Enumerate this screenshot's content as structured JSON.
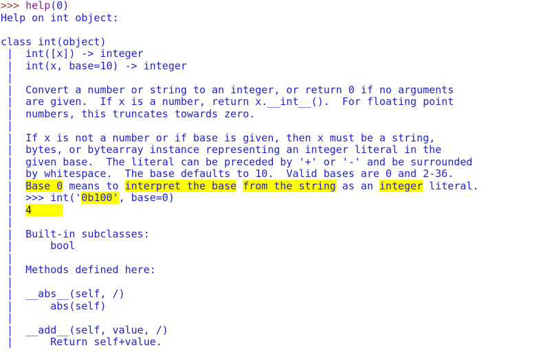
{
  "terminal": {
    "app": "python-repl-help-output",
    "background_color": "#ffffff",
    "text_color": "#2222cc",
    "prompt_color": "#9b3d1e",
    "function_color": "#8b1a8b",
    "highlight_color": "#ffff00",
    "font_size_px": 15,
    "line_height_px": 17.5,
    "columns": 80,
    "lines": [
      {
        "id": "line-1-prompt-help-call",
        "segments": [
          {
            "text": ">>> ",
            "style": "prompt"
          },
          {
            "text": "help",
            "style": "function"
          },
          {
            "text": "(0)",
            "style": "body"
          }
        ]
      },
      {
        "id": "line-2-help-on-int-object",
        "segments": [
          {
            "text": "Help on int object:",
            "style": "body"
          }
        ]
      },
      {
        "id": "line-3-blank",
        "segments": [
          {
            "text": "",
            "style": "body"
          }
        ]
      },
      {
        "id": "line-4-class-int-object",
        "segments": [
          {
            "text": "class int(object)",
            "style": "body"
          }
        ]
      },
      {
        "id": "line-5-signature-int-x",
        "segments": [
          {
            "text": " |  int([x]) -> integer",
            "style": "body"
          }
        ]
      },
      {
        "id": "line-6-signature-int-x-base",
        "segments": [
          {
            "text": " |  int(x, base=10) -> integer",
            "style": "body"
          }
        ]
      },
      {
        "id": "line-7-pipe",
        "segments": [
          {
            "text": " |  ",
            "style": "body"
          }
        ]
      },
      {
        "id": "line-8-convert-description",
        "segments": [
          {
            "text": " |  Convert a number or string to an integer, or return 0 if no arguments",
            "style": "body"
          }
        ]
      },
      {
        "id": "line-9-convert-description-cont",
        "segments": [
          {
            "text": " |  are given.  If x is a number, return x.__int__().  For floating point",
            "style": "body"
          }
        ]
      },
      {
        "id": "line-10-convert-description-cont2",
        "segments": [
          {
            "text": " |  numbers, this truncates towards zero.",
            "style": "body"
          }
        ]
      },
      {
        "id": "line-11-pipe",
        "segments": [
          {
            "text": " |  ",
            "style": "body"
          }
        ]
      },
      {
        "id": "line-12-if-x-not-number",
        "segments": [
          {
            "text": " |  If x is not a number or if base is given, then x must be a string,",
            "style": "body"
          }
        ]
      },
      {
        "id": "line-13-bytes-bytearray",
        "segments": [
          {
            "text": " |  bytes, or bytearray instance representing an integer literal in the",
            "style": "body"
          }
        ]
      },
      {
        "id": "line-14-given-base-literal",
        "segments": [
          {
            "text": " |  given base.  The literal can be preceded by '+' or '-' and be surrounded",
            "style": "body"
          }
        ]
      },
      {
        "id": "line-15-whitespace-base-defaults",
        "segments": [
          {
            "text": " |  by whitespace.  The base defaults to 10.  Valid bases are 0 and 2-36.",
            "style": "body"
          }
        ]
      },
      {
        "id": "line-16-base-0-means-highlighted",
        "segments": [
          {
            "text": " |  ",
            "style": "body"
          },
          {
            "text": "Base 0",
            "style": "highlight"
          },
          {
            "text": " means to ",
            "style": "body"
          },
          {
            "text": "interpret the base",
            "style": "highlight"
          },
          {
            "text": " ",
            "style": "body"
          },
          {
            "text": "from the string",
            "style": "highlight"
          },
          {
            "text": " as an ",
            "style": "body"
          },
          {
            "text": "integer",
            "style": "highlight"
          },
          {
            "text": " literal.",
            "style": "body"
          }
        ]
      },
      {
        "id": "line-17-example-int-call",
        "segments": [
          {
            "text": " |  >>> int('",
            "style": "body"
          },
          {
            "text": "0b100'",
            "style": "highlight"
          },
          {
            "text": ", base=0)",
            "style": "body"
          }
        ]
      },
      {
        "id": "line-18-example-result-4",
        "segments": [
          {
            "text": " |  ",
            "style": "body"
          },
          {
            "text": "4     ",
            "style": "highlight-dark"
          }
        ]
      },
      {
        "id": "line-19-pipe",
        "segments": [
          {
            "text": " |  ",
            "style": "body"
          }
        ]
      },
      {
        "id": "line-20-builtin-subclasses-header",
        "segments": [
          {
            "text": " |  Built-in subclasses:",
            "style": "body"
          }
        ]
      },
      {
        "id": "line-21-subclass-bool",
        "segments": [
          {
            "text": " |      bool",
            "style": "body"
          }
        ]
      },
      {
        "id": "line-22-pipe",
        "segments": [
          {
            "text": " |  ",
            "style": "body"
          }
        ]
      },
      {
        "id": "line-23-methods-defined-header",
        "segments": [
          {
            "text": " |  Methods defined here:",
            "style": "body"
          }
        ]
      },
      {
        "id": "line-24-pipe",
        "segments": [
          {
            "text": " |  ",
            "style": "body"
          }
        ]
      },
      {
        "id": "line-25-method-abs-signature",
        "segments": [
          {
            "text": " |  __abs__(self, /)",
            "style": "body"
          }
        ]
      },
      {
        "id": "line-26-method-abs-doc",
        "segments": [
          {
            "text": " |      abs(self)",
            "style": "body"
          }
        ]
      },
      {
        "id": "line-27-pipe",
        "segments": [
          {
            "text": " |  ",
            "style": "body"
          }
        ]
      },
      {
        "id": "line-28-method-add-signature",
        "segments": [
          {
            "text": " |  __add__(self, value, /)",
            "style": "body"
          }
        ]
      },
      {
        "id": "line-29-method-add-doc",
        "segments": [
          {
            "text": " |      Return self+value.",
            "style": "body"
          }
        ]
      }
    ]
  }
}
